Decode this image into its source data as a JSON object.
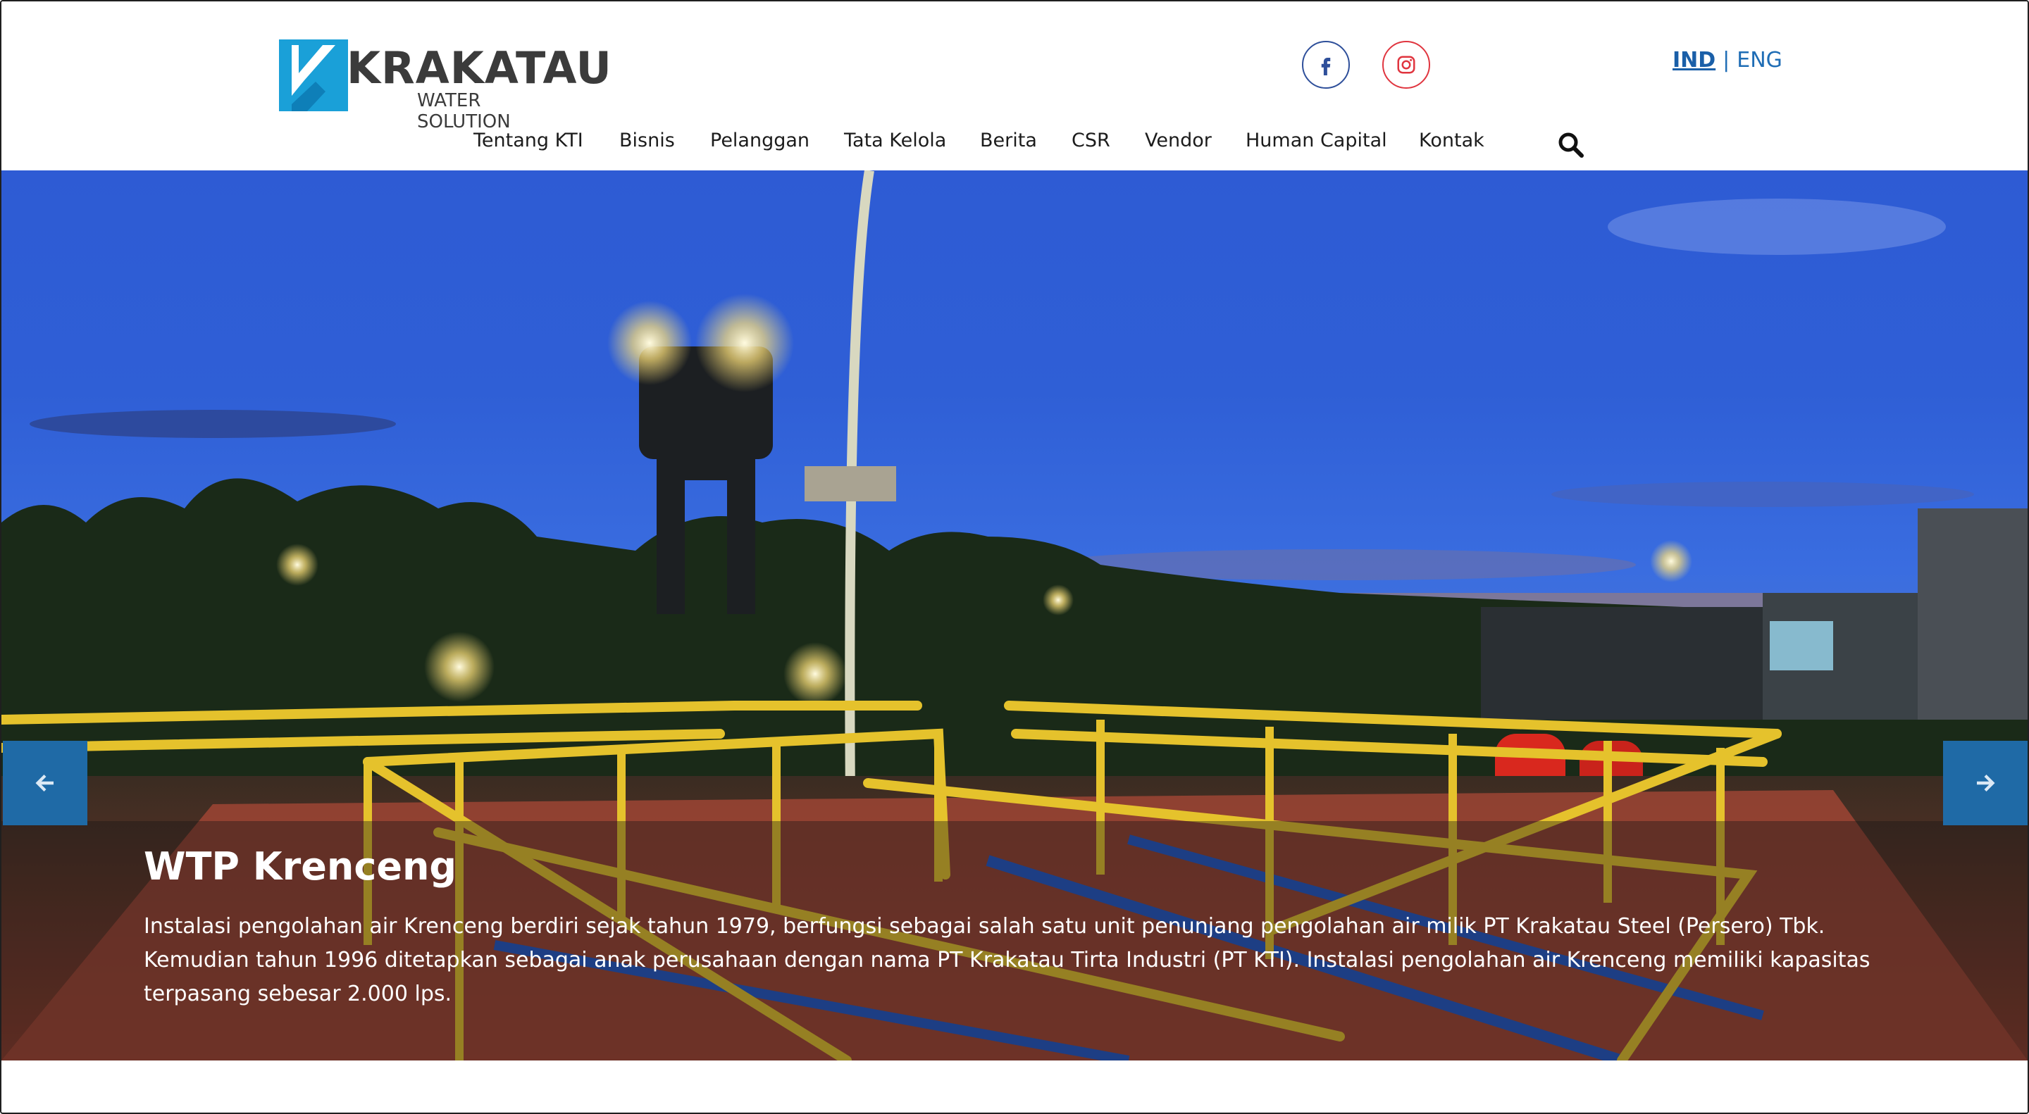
{
  "brand": {
    "name": "KRAKATAU",
    "tagline": "WATER SOLUTION",
    "logo_color": "#1aa0d8"
  },
  "social": [
    {
      "name": "facebook",
      "icon": "facebook-icon",
      "color": "#2e4f9a"
    },
    {
      "name": "instagram",
      "icon": "instagram-icon",
      "color": "#e0353f"
    }
  ],
  "language": {
    "active": "IND",
    "separator": "|",
    "other": "ENG"
  },
  "nav": {
    "items": [
      {
        "label": "Tentang KTI"
      },
      {
        "label": "Bisnis"
      },
      {
        "label": "Pelanggan"
      },
      {
        "label": "Tata Kelola"
      },
      {
        "label": "Berita"
      },
      {
        "label": "CSR"
      },
      {
        "label": "Vendor"
      },
      {
        "label": "Human Capital"
      },
      {
        "label": "Kontak"
      }
    ],
    "search_icon": "search-icon"
  },
  "slider": {
    "title": "WTP Krenceng",
    "description": "Instalasi pengolahan air Krenceng berdiri sejak tahun 1979, berfungsi sebagai salah satu unit penunjang pengolahan air milik PT Krakatau Steel (Persero) Tbk. Kemudian tahun 1996 ditetapkan sebagai anak perusahaan dengan nama PT Krakatau Tirta Industri (PT KTI). Instalasi pengolahan air Krenceng memiliki kapasitas terpasang sebesar 2.000 lps.",
    "prev_icon": "arrow-left-icon",
    "next_icon": "arrow-right-icon",
    "accent": "#1f6aa6"
  }
}
